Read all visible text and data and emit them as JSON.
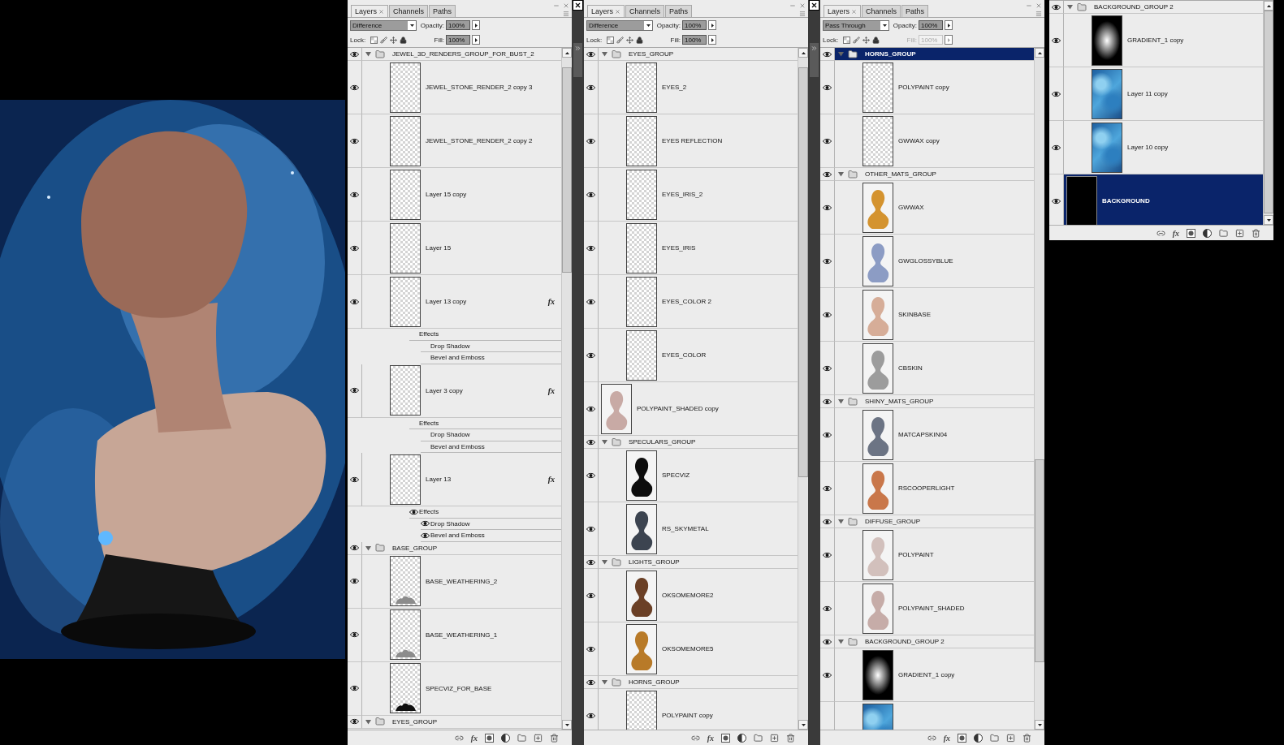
{
  "panels": [
    {
      "tabs": [
        {
          "label": "Layers",
          "selected": true
        },
        {
          "label": "Channels",
          "selected": false
        },
        {
          "label": "Paths",
          "selected": false
        }
      ],
      "blend_mode": "Difference",
      "opacity_label": "Opacity:",
      "opacity": "100%",
      "lock_label": "Lock:",
      "fill_label": "Fill:",
      "fill": "100%",
      "fill_disabled": false,
      "fx_button": "fx",
      "layers": [
        {
          "kind": "group",
          "name": "JEWEL_3D_RENDERS_GROUP_FOR_BUST_2",
          "visible": true,
          "expanded": true,
          "selected": false,
          "children": [
            {
              "kind": "layer",
              "name": "JEWEL_STONE_RENDER_2 copy 3",
              "visible": true,
              "selected": false,
              "thumb": {
                "kind": "transparent"
              }
            },
            {
              "kind": "layer",
              "name": "JEWEL_STONE_RENDER_2 copy 2",
              "visible": true,
              "selected": false,
              "thumb": {
                "kind": "transparent"
              }
            },
            {
              "kind": "layer",
              "name": "Layer 15 copy",
              "visible": true,
              "selected": false,
              "thumb": {
                "kind": "transparent"
              }
            },
            {
              "kind": "layer",
              "name": "Layer 15",
              "visible": true,
              "selected": false,
              "thumb": {
                "kind": "transparent"
              }
            },
            {
              "kind": "layer",
              "name": "Layer 13 copy",
              "visible": true,
              "selected": false,
              "thumb": {
                "kind": "transparent"
              },
              "fx": "fx",
              "effects": [
                {
                  "name": "Effects",
                  "visible": false,
                  "children": [
                    {
                      "name": "Drop Shadow",
                      "visible": false
                    },
                    {
                      "name": "Bevel and Emboss",
                      "visible": false
                    }
                  ]
                }
              ]
            },
            {
              "kind": "layer",
              "name": "Layer 3 copy",
              "visible": true,
              "selected": false,
              "thumb": {
                "kind": "transparent"
              },
              "fx": "fx",
              "effects": [
                {
                  "name": "Effects",
                  "visible": false,
                  "children": [
                    {
                      "name": "Drop Shadow",
                      "visible": false
                    },
                    {
                      "name": "Bevel and Emboss",
                      "visible": false
                    }
                  ]
                }
              ]
            },
            {
              "kind": "layer",
              "name": "Layer 13",
              "visible": true,
              "selected": false,
              "thumb": {
                "kind": "transparent"
              },
              "fx": "fx",
              "effects": [
                {
                  "name": "Effects",
                  "visible": true,
                  "children": [
                    {
                      "name": "Drop Shadow",
                      "visible": true
                    },
                    {
                      "name": "Bevel and Emboss",
                      "visible": true
                    }
                  ]
                }
              ]
            }
          ]
        },
        {
          "kind": "group",
          "name": "BASE_GROUP",
          "visible": true,
          "expanded": true,
          "selected": false,
          "children": [
            {
              "kind": "layer",
              "name": "BASE_WEATHERING_2",
              "visible": true,
              "selected": false,
              "thumb": {
                "kind": "smudge",
                "color": "#8c8c8c"
              }
            },
            {
              "kind": "layer",
              "name": "BASE_WEATHERING_1",
              "visible": true,
              "selected": false,
              "thumb": {
                "kind": "smudge",
                "color": "#8c8c8c"
              }
            },
            {
              "kind": "layer",
              "name": "SPECVIZ_FOR_BASE",
              "visible": true,
              "selected": false,
              "thumb": {
                "kind": "smudge",
                "color": "#101010"
              }
            }
          ]
        },
        {
          "kind": "group",
          "name": "EYES_GROUP",
          "visible": true,
          "expanded": true,
          "selected": false
        }
      ]
    },
    {
      "tabs": [
        {
          "label": "Layers",
          "selected": true
        },
        {
          "label": "Channels",
          "selected": false
        },
        {
          "label": "Paths",
          "selected": false
        }
      ],
      "blend_mode": "Difference",
      "opacity_label": "Opacity:",
      "opacity": "100%",
      "lock_label": "Lock:",
      "fill_label": "Fill:",
      "fill": "100%",
      "fill_disabled": false,
      "fx_button": "fx",
      "layers": [
        {
          "kind": "group",
          "name": "EYES_GROUP",
          "visible": true,
          "expanded": true,
          "selected": false,
          "children": [
            {
              "kind": "layer",
              "name": "EYES_2",
              "visible": true,
              "selected": false,
              "thumb": {
                "kind": "transparent"
              }
            },
            {
              "kind": "layer",
              "name": "EYES REFLECTION",
              "visible": true,
              "selected": false,
              "thumb": {
                "kind": "transparent"
              }
            },
            {
              "kind": "layer",
              "name": "EYES_IRIS_2",
              "visible": true,
              "selected": false,
              "thumb": {
                "kind": "transparent"
              }
            },
            {
              "kind": "layer",
              "name": "EYES_IRIS",
              "visible": true,
              "selected": false,
              "thumb": {
                "kind": "transparent"
              }
            },
            {
              "kind": "layer",
              "name": "EYES_COLOR 2",
              "visible": true,
              "selected": false,
              "thumb": {
                "kind": "transparent"
              }
            },
            {
              "kind": "layer",
              "name": "EYES_COLOR",
              "visible": true,
              "selected": false,
              "thumb": {
                "kind": "transparent"
              }
            }
          ]
        },
        {
          "kind": "layer",
          "name": "POLYPAINT_SHADED copy",
          "visible": true,
          "selected": false,
          "thumb": {
            "kind": "bust",
            "color": "#c8aaa5"
          }
        },
        {
          "kind": "group",
          "name": "SPECULARS_GROUP",
          "visible": true,
          "expanded": true,
          "selected": false,
          "children": [
            {
              "kind": "layer",
              "name": "SPECVIZ",
              "visible": true,
              "selected": false,
              "thumb": {
                "kind": "bust",
                "color": "#0d0d0d"
              }
            },
            {
              "kind": "layer",
              "name": "RS_SKYMETAL",
              "visible": true,
              "selected": false,
              "thumb": {
                "kind": "bust",
                "color": "#3c4450"
              }
            }
          ]
        },
        {
          "kind": "group",
          "name": "LIGHTS_GROUP",
          "visible": true,
          "expanded": true,
          "selected": false,
          "children": [
            {
              "kind": "layer",
              "name": "OKSOMEMORE2",
              "visible": true,
              "selected": false,
              "thumb": {
                "kind": "bust",
                "color": "#6b4026"
              }
            },
            {
              "kind": "layer",
              "name": "OKSOMEMORE5",
              "visible": true,
              "selected": false,
              "thumb": {
                "kind": "bust",
                "color": "#b87a28"
              }
            }
          ]
        },
        {
          "kind": "group",
          "name": "HORNS_GROUP",
          "visible": true,
          "expanded": true,
          "selected": false,
          "children": [
            {
              "kind": "layer",
              "name": "POLYPAINT copy",
              "visible": true,
              "selected": false,
              "thumb": {
                "kind": "transparent"
              }
            }
          ]
        }
      ]
    },
    {
      "tabs": [
        {
          "label": "Layers",
          "selected": true
        },
        {
          "label": "Channels",
          "selected": false
        },
        {
          "label": "Paths",
          "selected": false
        }
      ],
      "blend_mode": "Pass Through",
      "opacity_label": "Opacity:",
      "opacity": "100%",
      "lock_label": "Lock:",
      "fill_label": "Fill:",
      "fill": "100%",
      "fill_disabled": true,
      "fx_button": "fx",
      "layers": [
        {
          "kind": "group",
          "name": "HORNS_GROUP",
          "visible": true,
          "expanded": true,
          "selected": true,
          "children": [
            {
              "kind": "layer",
              "name": "POLYPAINT copy",
              "visible": true,
              "selected": false,
              "thumb": {
                "kind": "transparent"
              }
            },
            {
              "kind": "layer",
              "name": "GWWAX copy",
              "visible": true,
              "selected": false,
              "thumb": {
                "kind": "transparent"
              }
            }
          ]
        },
        {
          "kind": "group",
          "name": "OTHER_MATS_GROUP",
          "visible": true,
          "expanded": true,
          "selected": false,
          "children": [
            {
              "kind": "layer",
              "name": "GWWAX",
              "visible": true,
              "selected": false,
              "thumb": {
                "kind": "bust",
                "color": "#d4932f"
              }
            },
            {
              "kind": "layer",
              "name": "GWGLOSSYBLUE",
              "visible": true,
              "selected": false,
              "thumb": {
                "kind": "bust",
                "color": "#8c9cc4"
              }
            },
            {
              "kind": "layer",
              "name": "SKINBASE",
              "visible": true,
              "selected": false,
              "thumb": {
                "kind": "bust",
                "color": "#d6ad98"
              }
            },
            {
              "kind": "layer",
              "name": "CBSKIN",
              "visible": true,
              "selected": false,
              "thumb": {
                "kind": "bust",
                "color": "#9c9c9c"
              }
            }
          ]
        },
        {
          "kind": "group",
          "name": "SHINY_MATS_GROUP",
          "visible": true,
          "expanded": true,
          "selected": false,
          "children": [
            {
              "kind": "layer",
              "name": "MATCAPSKIN04",
              "visible": true,
              "selected": false,
              "thumb": {
                "kind": "bust",
                "color": "#6c7484"
              }
            },
            {
              "kind": "layer",
              "name": "RSCOOPERLIGHT",
              "visible": true,
              "selected": false,
              "thumb": {
                "kind": "bust",
                "color": "#c9774a"
              }
            }
          ]
        },
        {
          "kind": "group",
          "name": "DIFFUSE_GROUP",
          "visible": true,
          "expanded": true,
          "selected": false,
          "children": [
            {
              "kind": "layer",
              "name": "POLYPAINT",
              "visible": true,
              "selected": false,
              "thumb": {
                "kind": "bust",
                "color": "#d2c0bc"
              }
            },
            {
              "kind": "layer",
              "name": "POLYPAINT_SHADED",
              "visible": true,
              "selected": false,
              "thumb": {
                "kind": "bust",
                "color": "#c6aca8"
              }
            }
          ]
        },
        {
          "kind": "group",
          "name": "BACKGROUND_GROUP 2",
          "visible": true,
          "expanded": true,
          "selected": false,
          "children": [
            {
              "kind": "layer",
              "name": "GRADIENT_1 copy",
              "visible": true,
              "selected": false,
              "thumb": {
                "kind": "gradient"
              }
            },
            {
              "kind": "layer",
              "visible": false,
              "selected": false,
              "thumb": {
                "kind": "texture"
              }
            }
          ]
        }
      ]
    },
    {
      "fx_button": "fx",
      "layers": [
        {
          "kind": "group",
          "name": "BACKGROUND_GROUP 2",
          "visible": true,
          "expanded": true,
          "selected": false,
          "children": [
            {
              "kind": "layer",
              "name": "GRADIENT_1 copy",
              "visible": true,
              "selected": false,
              "thumb": {
                "kind": "gradient"
              }
            },
            {
              "kind": "layer",
              "name": "Layer 11 copy",
              "visible": true,
              "selected": false,
              "thumb": {
                "kind": "texture"
              }
            },
            {
              "kind": "layer",
              "name": "Layer 10 copy",
              "visible": true,
              "selected": false,
              "thumb": {
                "kind": "texture"
              }
            }
          ]
        },
        {
          "kind": "layer",
          "name": "BACKGROUND",
          "visible": true,
          "selected": true,
          "thumb": {
            "kind": "black"
          }
        }
      ]
    }
  ]
}
